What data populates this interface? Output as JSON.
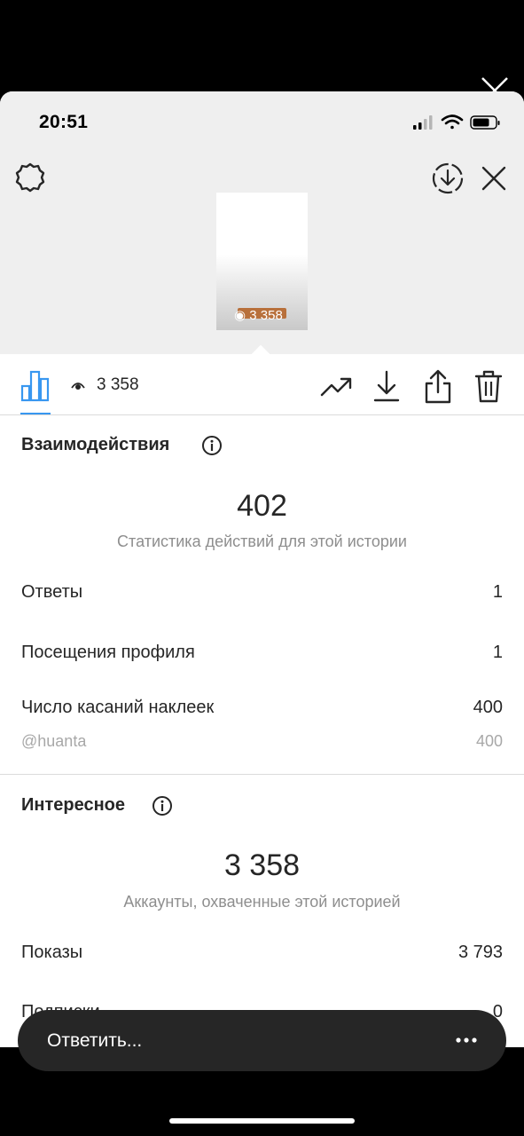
{
  "status_bar": {
    "time": "20:51"
  },
  "story_preview": {
    "views_label": "3 358"
  },
  "toolbar": {
    "views_count": "3 358"
  },
  "interactions": {
    "title": "Взаимодействия",
    "total": "402",
    "caption": "Статистика действий для этой истории",
    "rows": [
      {
        "label": "Ответы",
        "value": "1"
      },
      {
        "label": "Посещения профиля",
        "value": "1"
      },
      {
        "label": "Число касаний наклеек",
        "value": "400"
      }
    ],
    "sticker_rows": [
      {
        "label": "@huanta",
        "value": "400"
      }
    ]
  },
  "discovery": {
    "title": "Интересное",
    "total": "3 358",
    "caption": "Аккаунты, охваченные этой историей",
    "rows": [
      {
        "label": "Показы",
        "value": "3 793"
      },
      {
        "label": "Подписки",
        "value": "0"
      }
    ]
  },
  "reply": {
    "placeholder": "Ответить..."
  },
  "colors": {
    "accent": "#3897f0",
    "reply_bar": "#262626",
    "header_bg": "#efefef"
  }
}
